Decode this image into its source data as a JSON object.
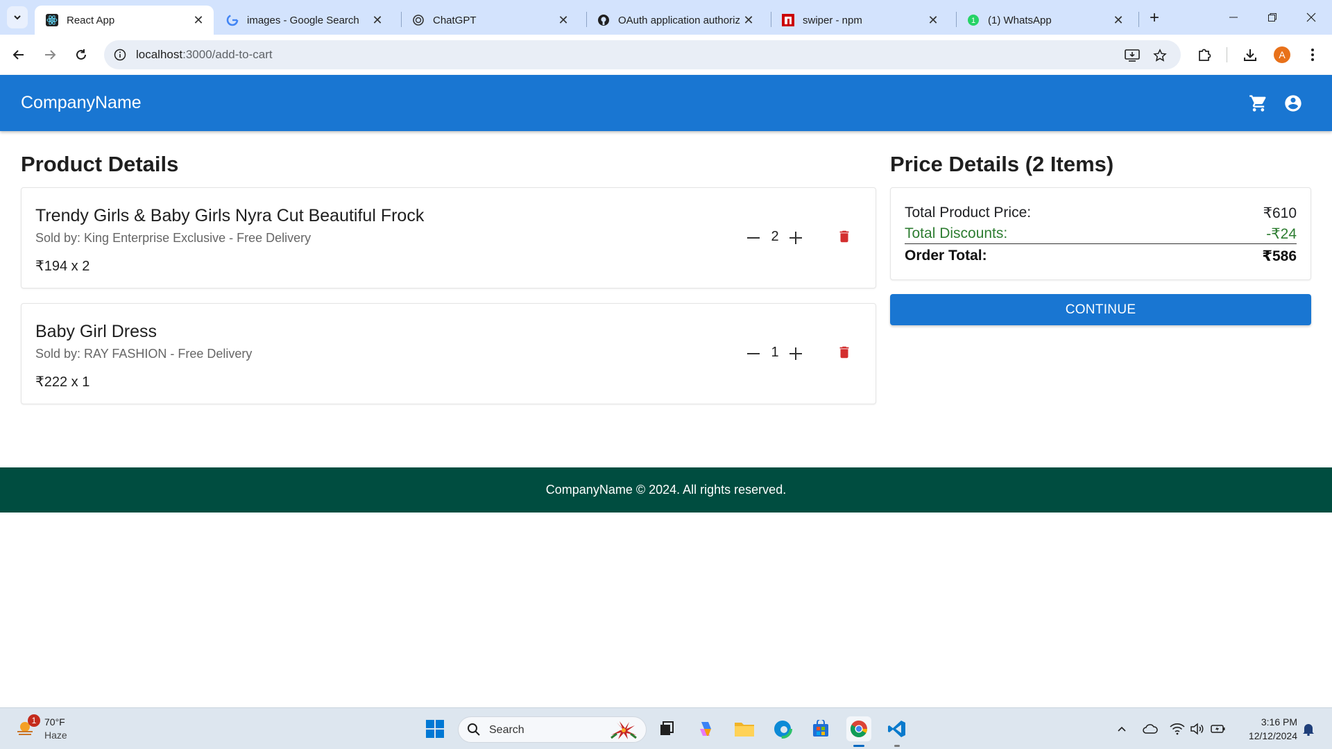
{
  "browser": {
    "tabs": [
      {
        "title": "React App",
        "active": true,
        "favicon": "react-icon"
      },
      {
        "title": "images - Google Search",
        "active": false,
        "favicon": "google-icon"
      },
      {
        "title": "ChatGPT",
        "active": false,
        "favicon": "chatgpt-icon"
      },
      {
        "title": "OAuth application authoriz",
        "active": false,
        "favicon": "github-icon"
      },
      {
        "title": "swiper - npm",
        "active": false,
        "favicon": "npm-icon"
      },
      {
        "title": "(1) WhatsApp",
        "active": false,
        "favicon": "whatsapp-icon"
      }
    ],
    "url_host": "localhost",
    "url_path": ":3000/add-to-cart",
    "profile_initial": "A"
  },
  "app": {
    "brand": "CompanyName",
    "header_icons": [
      "cart-icon",
      "account-circle-icon"
    ]
  },
  "product_section": {
    "title": "Product Details",
    "items": [
      {
        "name": "Trendy Girls & Baby Girls Nyra Cut Beautiful Frock",
        "seller": "Sold by: King Enterprise Exclusive - Free Delivery",
        "price_line": "₹194 x 2",
        "quantity": "2"
      },
      {
        "name": "Baby Girl Dress",
        "seller": "Sold by: RAY FASHION - Free Delivery",
        "price_line": "₹222 x 1",
        "quantity": "1"
      }
    ]
  },
  "price_section": {
    "title": "Price Details (2 Items)",
    "rows": [
      {
        "label": "Total Product Price:",
        "value": "₹610"
      },
      {
        "label": "Total Discounts:",
        "value": "-₹24"
      },
      {
        "label": "Order Total:",
        "value": "₹586"
      }
    ],
    "discount_color": "#2e7d32",
    "continue_label": "CONTINUE"
  },
  "footer": {
    "text": "CompanyName © 2024. All rights reserved."
  },
  "taskbar": {
    "weather_temp": "70°F",
    "weather_cond": "Haze",
    "weather_badge": "1",
    "search_placeholder": "Search",
    "time": "3:16 PM",
    "date": "12/12/2024"
  },
  "colors": {
    "appbar": "#1976d2",
    "footer": "#004d40",
    "delete": "#d32f2f",
    "tabbar": "#d3e3fd"
  }
}
